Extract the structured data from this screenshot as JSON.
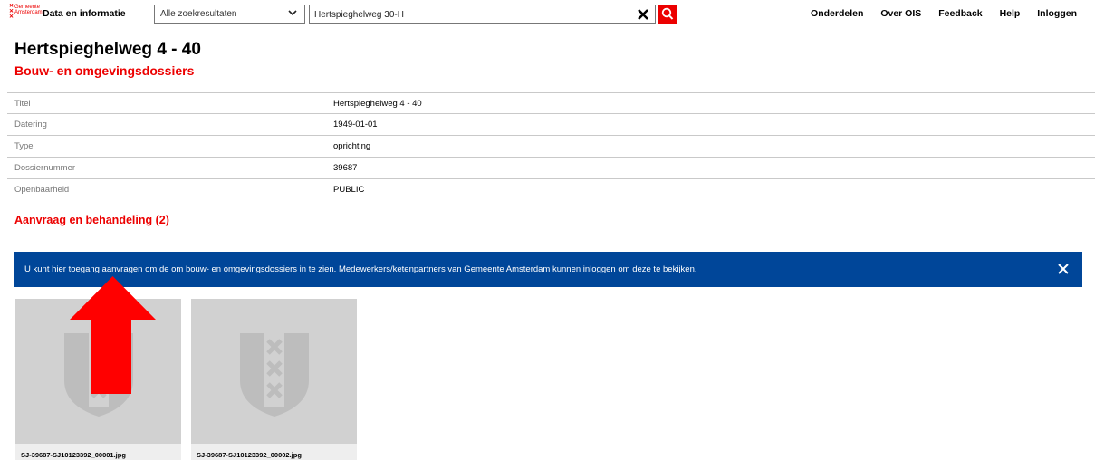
{
  "header": {
    "logo_text": "Gemeente Amsterdam",
    "app_title": "Data en informatie",
    "scope_select": "Alle zoekresultaten",
    "search_value": "Hertspieghelweg 30-H",
    "nav": [
      "Onderdelen",
      "Over OIS",
      "Feedback",
      "Help",
      "Inloggen"
    ]
  },
  "page": {
    "title": "Hertspieghelweg 4 - 40",
    "subtitle": "Bouw- en omgevingsdossiers"
  },
  "details": [
    {
      "label": "Titel",
      "value": "Hertspieghelweg 4 - 40"
    },
    {
      "label": "Datering",
      "value": "1949-01-01"
    },
    {
      "label": "Type",
      "value": "oprichting"
    },
    {
      "label": "Dossiernummer",
      "value": "39687"
    },
    {
      "label": "Openbaarheid",
      "value": "PUBLIC"
    }
  ],
  "section_title": "Aanvraag en behandeling (2)",
  "banner": {
    "text_1": "U kunt hier ",
    "link_1": "toegang aanvragen",
    "text_2": " om de om bouw- en omgevingsdossiers in te zien. Medewerkers/ketenpartners van Gemeente Amsterdam kunnen ",
    "link_2": "inloggen",
    "text_3": " om deze te bekijken."
  },
  "files": [
    {
      "name": "SJ-39687-SJ10123392_00001.jpg"
    },
    {
      "name": "SJ-39687-SJ10123392_00002.jpg"
    }
  ],
  "colors": {
    "accent_red": "#ec0000",
    "banner_blue": "#004699"
  }
}
